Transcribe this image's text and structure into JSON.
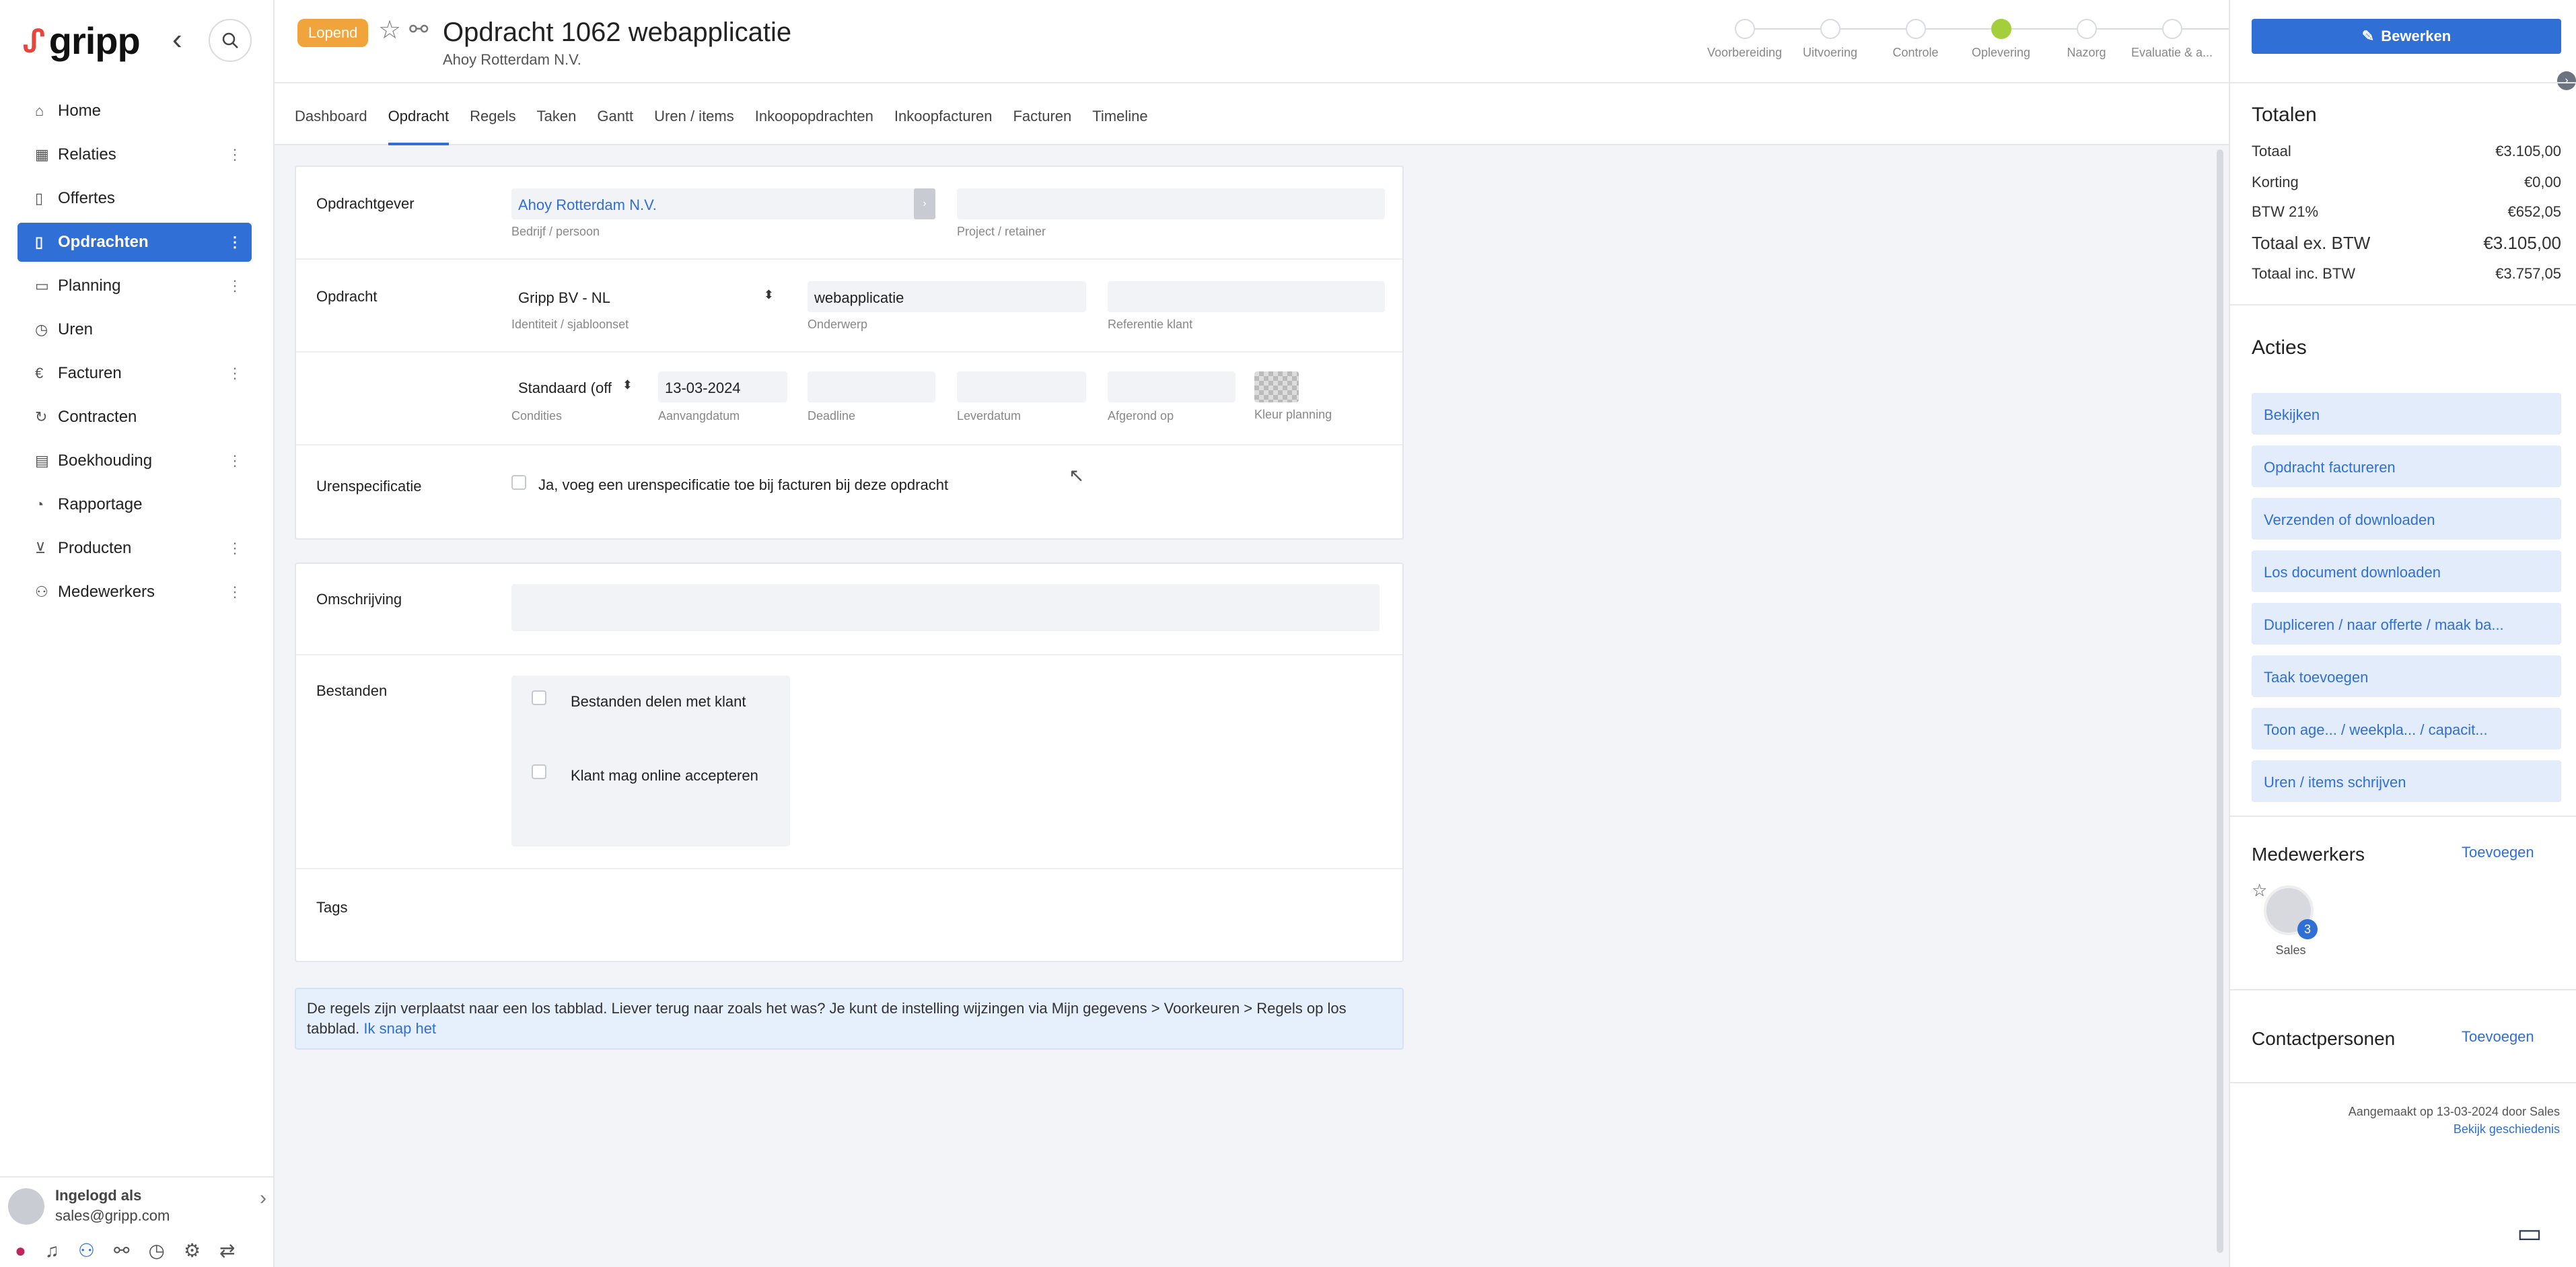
{
  "sidebar": {
    "logo_text": "gripp",
    "items": [
      {
        "label": "Home",
        "icon": "home-icon",
        "glyph": "⌂",
        "dots": false,
        "active": false
      },
      {
        "label": "Relaties",
        "icon": "building-icon",
        "glyph": "▦",
        "dots": true,
        "active": false
      },
      {
        "label": "Offertes",
        "icon": "document-icon",
        "glyph": "▯",
        "dots": false,
        "active": false
      },
      {
        "label": "Opdrachten",
        "icon": "document-icon",
        "glyph": "▯",
        "dots": true,
        "active": true
      },
      {
        "label": "Planning",
        "icon": "calendar-icon",
        "glyph": "▭",
        "dots": true,
        "active": false
      },
      {
        "label": "Uren",
        "icon": "stopwatch-icon",
        "glyph": "◷",
        "dots": false,
        "active": false
      },
      {
        "label": "Facturen",
        "icon": "euro-icon",
        "glyph": "€",
        "dots": true,
        "active": false
      },
      {
        "label": "Contracten",
        "icon": "refresh-icon",
        "glyph": "↻",
        "dots": false,
        "active": false
      },
      {
        "label": "Boekhouding",
        "icon": "table-icon",
        "glyph": "▤",
        "dots": true,
        "active": false
      },
      {
        "label": "Rapportage",
        "icon": "pie-chart-icon",
        "glyph": "◔",
        "dots": false,
        "active": false
      },
      {
        "label": "Producten",
        "icon": "cart-icon",
        "glyph": "⊻",
        "dots": true,
        "active": false
      },
      {
        "label": "Medewerkers",
        "icon": "users-icon",
        "glyph": "⚇",
        "dots": true,
        "active": false
      }
    ],
    "user": {
      "label": "Ingelogd als",
      "email": "sales@gripp.com"
    }
  },
  "header": {
    "status_badge": "Lopend",
    "title": "Opdracht 1062 webapplicatie",
    "subtitle": "Ahoy Rotterdam N.V.",
    "steps": [
      {
        "label": "Voorbereiding",
        "done": false
      },
      {
        "label": "Uitvoering",
        "done": false
      },
      {
        "label": "Controle",
        "done": false
      },
      {
        "label": "Oplevering",
        "done": true
      },
      {
        "label": "Nazorg",
        "done": false
      },
      {
        "label": "Evaluatie & a...",
        "done": false
      }
    ]
  },
  "tabs": [
    {
      "label": "Dashboard",
      "active": false
    },
    {
      "label": "Opdracht",
      "active": true
    },
    {
      "label": "Regels",
      "active": false
    },
    {
      "label": "Taken",
      "active": false
    },
    {
      "label": "Gantt",
      "active": false
    },
    {
      "label": "Uren / items",
      "active": false
    },
    {
      "label": "Inkoopopdrachten",
      "active": false
    },
    {
      "label": "Inkoopfacturen",
      "active": false
    },
    {
      "label": "Facturen",
      "active": false
    },
    {
      "label": "Timeline",
      "active": false
    }
  ],
  "form": {
    "opdrachtgever": {
      "label": "Opdrachtgever",
      "company_value": "Ahoy Rotterdam N.V.",
      "company_hint": "Bedrijf / persoon",
      "project_value": "",
      "project_hint": "Project / retainer"
    },
    "opdracht": {
      "label": "Opdracht",
      "identity_value": "Gripp BV - NL",
      "identity_hint": "Identiteit / sjabloonset",
      "subject_value": "webapplicatie",
      "subject_hint": "Onderwerp",
      "reference_value": "",
      "reference_hint": "Referentie klant"
    },
    "dates": {
      "conditions_value": "Standaard (off",
      "conditions_hint": "Condities",
      "start_value": "13-03-2024",
      "start_hint": "Aanvangdatum",
      "deadline_hint": "Deadline",
      "delivery_hint": "Leverdatum",
      "finished_hint": "Afgerond op",
      "color_hint": "Kleur planning"
    },
    "hours": {
      "label": "Urenspecificatie",
      "checkbox_label": "Ja, voeg een urenspecificatie toe bij facturen bij deze opdracht"
    },
    "description": {
      "label": "Omschrijving",
      "value": ""
    },
    "files": {
      "label": "Bestanden",
      "share_label": "Bestanden delen met klant",
      "accept_label": "Klant mag online accepteren"
    },
    "tags": {
      "label": "Tags"
    }
  },
  "notice": {
    "text": "De regels zijn verplaatst naar een los tabblad. Liever terug naar zoals het was? Je kunt de instelling wijzingen via Mijn gegevens > Voorkeuren > Regels op los tabblad.",
    "link": "Ik snap het"
  },
  "right": {
    "edit_button": "Bewerken",
    "totals_title": "Totalen",
    "totals": [
      {
        "label": "Totaal",
        "value": "€3.105,00",
        "big": false
      },
      {
        "label": "Korting",
        "value": "€0,00",
        "big": false
      },
      {
        "label": "BTW 21%",
        "value": "€652,05",
        "big": false
      },
      {
        "label": "Totaal ex. BTW",
        "value": "€3.105,00",
        "big": true
      },
      {
        "label": "Totaal inc. BTW",
        "value": "€3.757,05",
        "big": false
      }
    ],
    "actions_title": "Acties",
    "actions": [
      "Bekijken",
      "Opdracht factureren",
      "Verzenden of downloaden",
      "Los document downloaden",
      "Dupliceren / naar offerte / maak ba...",
      "Taak toevoegen",
      "Toon age...    / weekpla...    / capacit...",
      "Uren / items schrijven"
    ],
    "employees_title": "Medewerkers",
    "employees_add": "Toevoegen",
    "employee": {
      "name": "Sales",
      "count": "3"
    },
    "contacts_title": "Contactpersonen",
    "contacts_add": "Toevoegen",
    "created": "Aangemaakt op 13-03-2024 door Sales",
    "history_link": "Bekijk geschiedenis"
  },
  "colors": {
    "accent": "#2f6fd6",
    "badge": "#f1a43c",
    "step_done": "#a5cf3a"
  }
}
